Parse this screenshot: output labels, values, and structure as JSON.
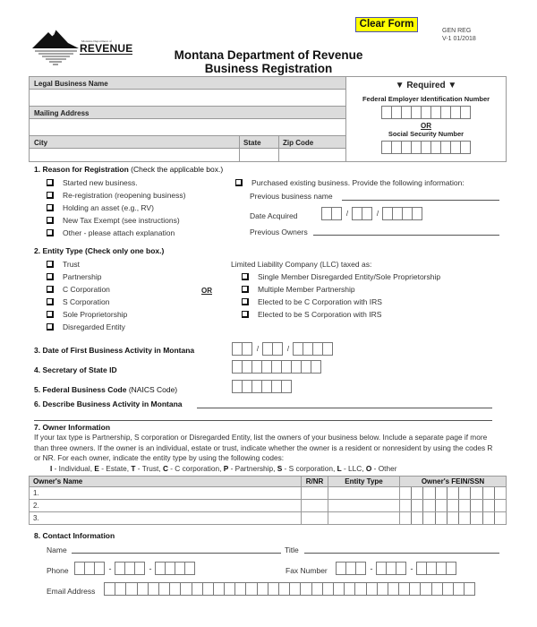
{
  "header": {
    "logo": {
      "small_text": "Montana Department of",
      "word": "REVENUE"
    },
    "title_line1": "Montana Department of Revenue",
    "title_line2": "Business Registration",
    "clear_button": "Clear Form",
    "form_id_line1": "GEN REG",
    "form_id_line2": "V-1  01/2018"
  },
  "top_box": {
    "legal_name_label": "Legal Business Name",
    "mailing_address_label": "Mailing Address",
    "city_label": "City",
    "state_label": "State",
    "zip_label": "Zip Code",
    "required_title": "▼ Required ▼",
    "fein_label": "Federal Employer Identification Number",
    "fein_boxes": 9,
    "or_label": "OR",
    "ssn_label": "Social Security Number",
    "ssn_boxes": 9
  },
  "section1": {
    "title_bold": "1. Reason for Registration",
    "title_normal": " (Check the applicable box.)",
    "options": [
      "Started new business.",
      "Re-registration (reopening business)",
      "Holding an asset (e.g., RV)",
      "New Tax Exempt (see instructions)",
      "Other - please attach explanation"
    ],
    "purchased": "Purchased existing business.  Provide the following information:",
    "prev_name_label": "Previous business name",
    "date_acquired_label": "Date Acquired",
    "prev_owners_label": "Previous Owners",
    "date_sep": "/"
  },
  "section2": {
    "title": "2. Entity Type (Check only one box.)",
    "options": [
      "Trust",
      "Partnership",
      "C Corporation",
      "S Corporation",
      "Sole Proprietorship",
      "Disregarded Entity"
    ],
    "or_label": "OR",
    "llc_label": "Limited Liability Company (LLC) taxed as:",
    "llc_options": [
      "Single Member Disregarded Entity/Sole Proprietorship",
      "Multiple Member Partnership",
      "Elected to be C Corporation with IRS",
      "Elected to be S Corporation with IRS"
    ]
  },
  "section3": {
    "label": "3. Date of First Business Activity in Montana",
    "sep": "/"
  },
  "section4": {
    "label": "4. Secretary of State ID",
    "boxes": 9
  },
  "section5": {
    "label_bold": "5. Federal Business Code",
    "label_normal": " (NAICS Code)",
    "boxes": 6
  },
  "section6": {
    "label": "6. Describe Business Activity in Montana"
  },
  "section7": {
    "title": "7. Owner Information",
    "paragraph": "If your tax type is Partnership, S corporation or Disregarded Entity, list the owners of your business below. Include a separate page if more than three owners. If the owner is an individual, estate or trust, indicate whether the owner is a resident or nonresident by using the codes R or NR. For each owner, indicate the entity type by using the following codes:",
    "codes": [
      {
        "code": "I",
        "desc": " - Individual, "
      },
      {
        "code": "E",
        "desc": " - Estate, "
      },
      {
        "code": "T",
        "desc": " - Trust, "
      },
      {
        "code": "C",
        "desc": " - C corporation, "
      },
      {
        "code": "P",
        "desc": " - Partnership, "
      },
      {
        "code": "S",
        "desc": " - S corporation, "
      },
      {
        "code": "L",
        "desc": " - LLC, "
      },
      {
        "code": "O",
        "desc": " - Other"
      }
    ],
    "table": {
      "headers": [
        "Owner's Name",
        "R/NR",
        "Entity Type",
        "Owner's FEIN/SSN"
      ],
      "rows": [
        "1.",
        "2.",
        "3."
      ]
    }
  },
  "section8": {
    "title": "8. Contact Information",
    "name_label": "Name",
    "title_label": "Title",
    "phone_label": "Phone",
    "fax_label": "Fax Number",
    "email_label": "Email Address",
    "sep": "-",
    "email_boxes": 34
  }
}
